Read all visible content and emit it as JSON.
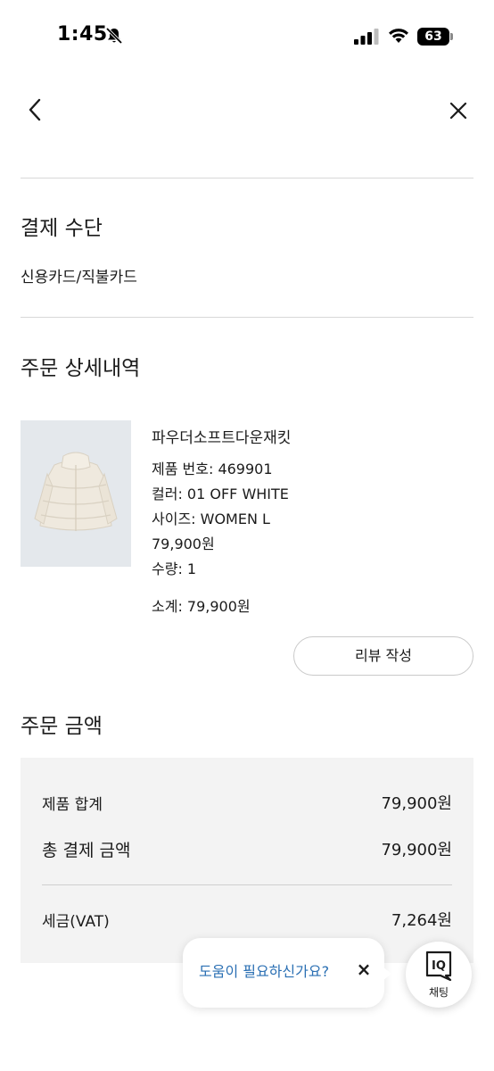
{
  "status_bar": {
    "time": "1:45",
    "battery": "63",
    "icons": [
      "bell-slash-icon",
      "signal-icon",
      "wifi-icon",
      "battery-icon"
    ]
  },
  "nav": {
    "icons": [
      "chevron-left-icon",
      "close-icon"
    ]
  },
  "payment": {
    "title": "결제 수단",
    "method": "신용카드/직불카드"
  },
  "order_detail": {
    "title": "주문 상세내역",
    "product": {
      "name": "파우더소프트다운재킷",
      "number": "제품 번호: 469901",
      "color": "컬러: 01 OFF WHITE",
      "size": "사이즈: WOMEN L",
      "price": "79,900원",
      "quantity": "수량: 1",
      "subtotal": "소계: 79,900원",
      "image_alt": "off-white puffer down jacket"
    },
    "review_button": "리뷰 작성"
  },
  "order_amount": {
    "title": "주문 금액",
    "product_total_label": "제품 합계",
    "product_total_value": "79,900원",
    "grand_total_label": "총 결제 금액",
    "grand_total_value": "79,900원",
    "tax_label": "세금(VAT)",
    "tax_value": "7,264원"
  },
  "help": {
    "text": "도움이 필요하신가요?",
    "close": "×",
    "chat_label": "채팅",
    "chat_logo": "IQ"
  },
  "colors": {
    "link": "#2a6fb3",
    "divider": "#d8d8d8",
    "summary_bg": "#f3f3f3"
  }
}
